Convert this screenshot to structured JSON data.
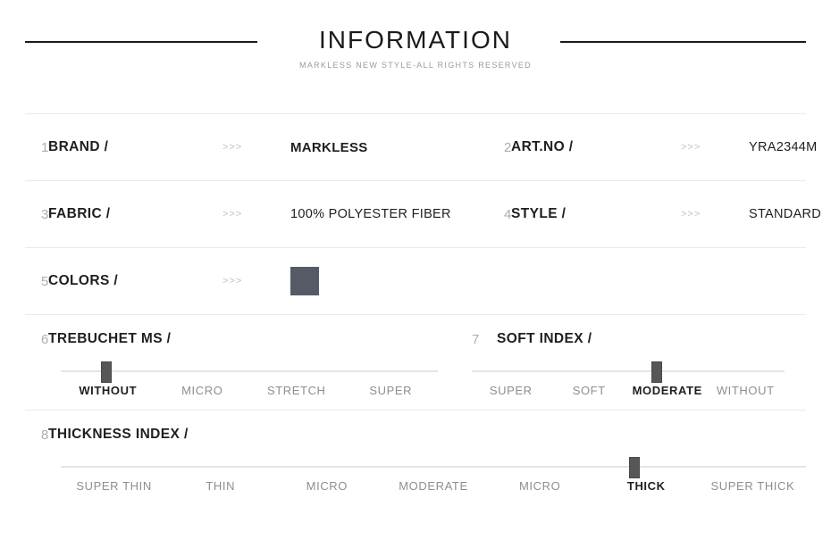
{
  "header": {
    "title": "INFORMATION",
    "subtitle": "MARKLESS  NEW STYLE-ALL RIGHTS RESERVED",
    "rule_color": "#1a1a1a"
  },
  "separator": ">>>",
  "rows": [
    {
      "index": "1",
      "label": "BRAND /",
      "chevron": ">>>",
      "value": "MARKLESS",
      "index2": "2",
      "label2": "ART.NO /",
      "chevron2": ">>>",
      "value2": "YRA2344M"
    },
    {
      "index": "3",
      "label": "FABRIC /",
      "chevron": ">>>",
      "value": "100% POLYESTER FIBER",
      "index2": "4",
      "label2": "STYLE /",
      "chevron2": ">>>",
      "value2": "STANDARD"
    }
  ],
  "colors_row": {
    "index": "5",
    "label": "COLORS /",
    "chevron": ">>>",
    "swatch_color": "#565a66"
  },
  "sliders": [
    {
      "index": "6",
      "label": "TREBUCHET MS /",
      "ticks": [
        "WITHOUT",
        "MICRO",
        "STRETCH",
        "SUPER"
      ],
      "selected": "WITHOUT",
      "selected_index": 0,
      "handle_percent": 12
    },
    {
      "index": "7",
      "label": "SOFT INDEX /",
      "ticks": [
        "SUPER",
        "SOFT",
        "MODERATE",
        "WITHOUT"
      ],
      "selected": "MODERATE",
      "selected_index": 2,
      "handle_percent": 59
    },
    {
      "index": "8",
      "label": "THICKNESS INDEX /",
      "ticks": [
        "SUPER THIN",
        "THIN",
        "MICRO",
        "MODERATE",
        "MICRO",
        "THICK",
        "SUPER THICK"
      ],
      "selected": "THICK",
      "selected_index": 5,
      "handle_percent": 77
    }
  ]
}
